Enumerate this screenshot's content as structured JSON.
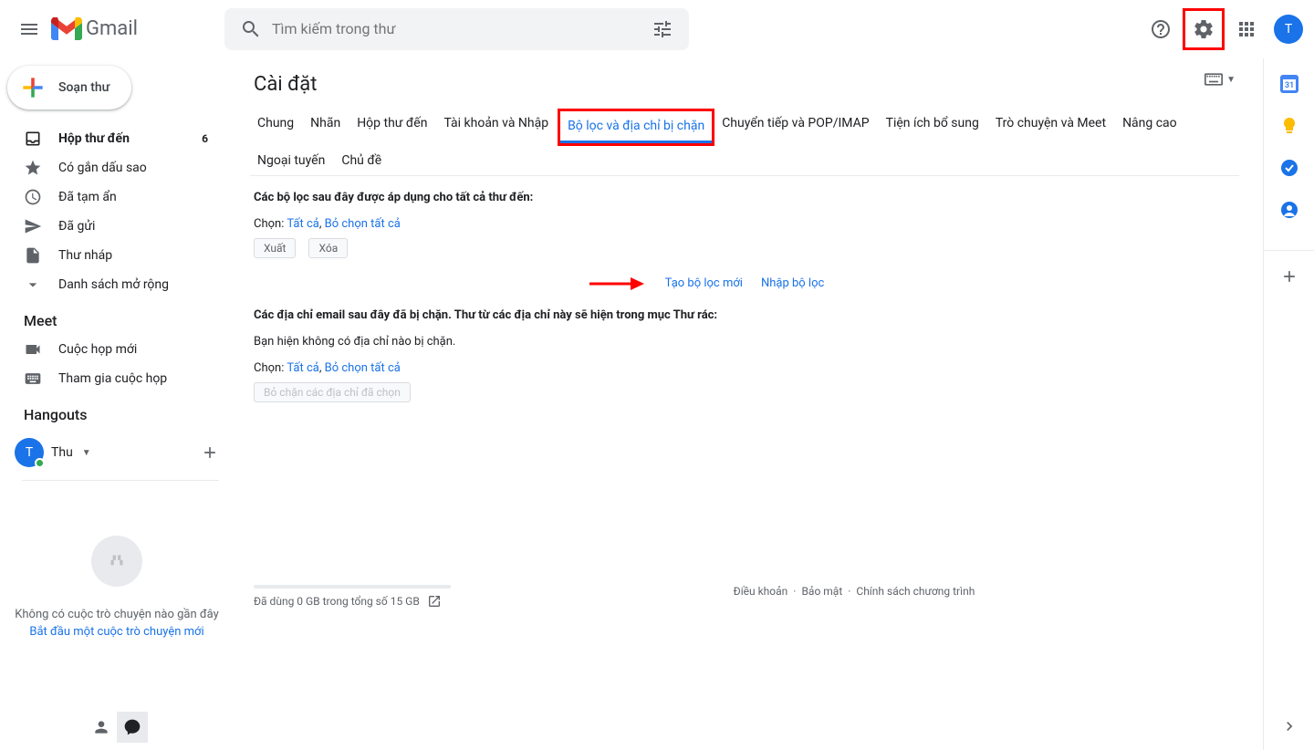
{
  "header": {
    "product_name": "Gmail",
    "search_placeholder": "Tìm kiếm trong thư",
    "avatar_initial": "T"
  },
  "compose_label": "Soạn thư",
  "nav": [
    {
      "label": "Hộp thư đến",
      "count": "6"
    },
    {
      "label": "Có gắn dấu sao"
    },
    {
      "label": "Đã tạm ẩn"
    },
    {
      "label": "Đã gửi"
    },
    {
      "label": "Thư nháp"
    },
    {
      "label": "Danh sách mở rộng"
    }
  ],
  "meet_header": "Meet",
  "meet_items": [
    {
      "label": "Cuộc họp mới"
    },
    {
      "label": "Tham gia cuộc họp"
    }
  ],
  "hangouts_header": "Hangouts",
  "hangouts_user": "Thu",
  "hangouts_empty": "Không có cuộc trò chuyện nào gần đây",
  "hangouts_start": "Bắt đầu một cuộc trò chuyện mới",
  "settings": {
    "title": "Cài đặt",
    "tabs": [
      "Chung",
      "Nhãn",
      "Hộp thư đến",
      "Tài khoản và Nhập",
      "Bộ lọc và địa chỉ bị chặn",
      "Chuyển tiếp và POP/IMAP",
      "Tiện ích bổ sung",
      "Trò chuyện và Meet",
      "Nâng cao",
      "Ngoại tuyến",
      "Chủ đề"
    ],
    "filters_applied": "Các bộ lọc sau đây được áp dụng cho tất cả thư đến:",
    "select_label": "Chọn:",
    "select_all": "Tất cả",
    "deselect_all": "Bỏ chọn tất cả",
    "export_btn": "Xuất",
    "delete_btn": "Xóa",
    "create_filter": "Tạo bộ lọc mới",
    "import_filter": "Nhập bộ lọc",
    "blocked_header": "Các địa chỉ email sau đây đã bị chặn. Thư từ các địa chỉ này sẽ hiện trong mục Thư rác:",
    "no_blocked": "Bạn hiện không có địa chỉ nào bị chặn.",
    "unblock_btn": "Bỏ chặn các địa chỉ đã chọn"
  },
  "footer": {
    "storage": "Đã dùng 0 GB trong tổng số 15 GB",
    "terms": "Điều khoản",
    "privacy": "Bảo mật",
    "policies": "Chính sách chương trình"
  }
}
